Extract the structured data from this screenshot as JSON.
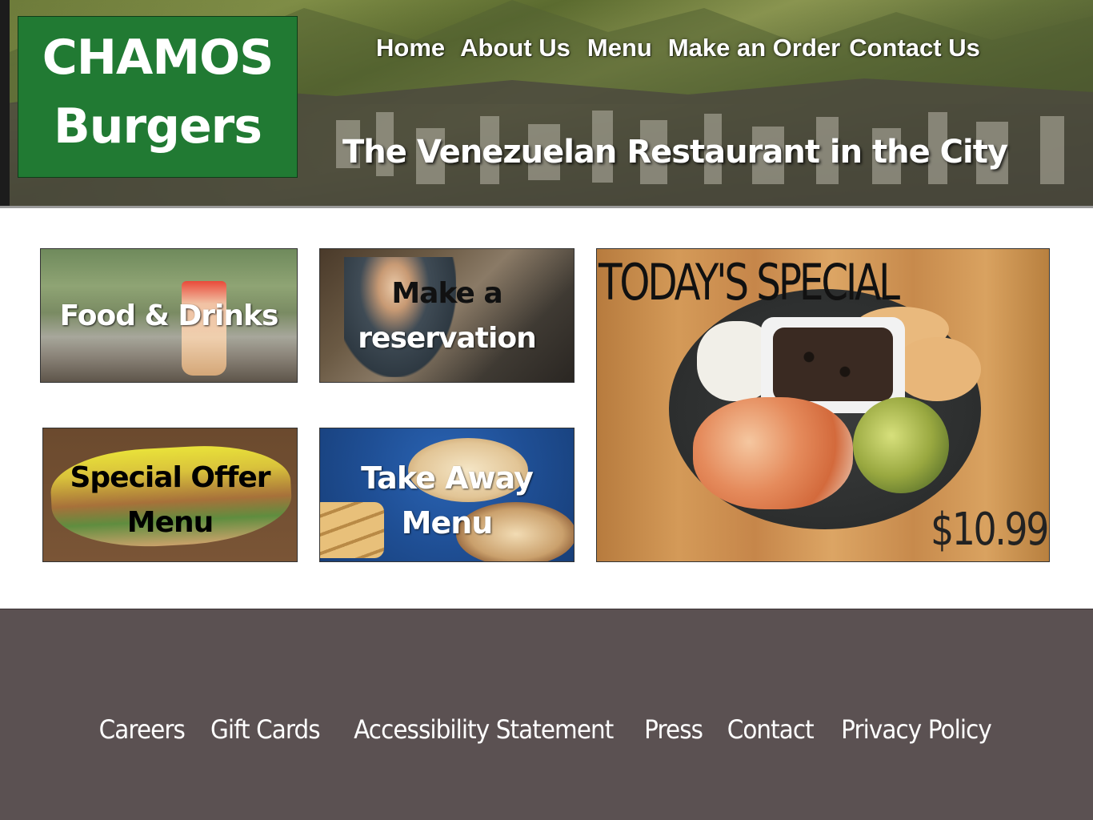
{
  "brand": {
    "line1": "CHAMOS",
    "line2": "Burgers",
    "color": "#217a33"
  },
  "nav": [
    {
      "label": "Home"
    },
    {
      "label": "About Us"
    },
    {
      "label": "Menu"
    },
    {
      "label": "Make an Order"
    },
    {
      "label": "Contact Us"
    }
  ],
  "tagline": "The Venezuelan Restaurant in the City",
  "tiles": {
    "food_drinks": {
      "label": "Food & Drinks"
    },
    "reservation": {
      "label_line1": "Make a",
      "label_line2": "reservation"
    },
    "special_offer": {
      "label_line1": "Special Offer",
      "label_line2": "Menu"
    },
    "take_away": {
      "label_line1": "Take Away",
      "label_line2": "Menu"
    },
    "todays_special": {
      "title": "TODAY'S SPECIAL",
      "price": "$10.99"
    }
  },
  "footer": {
    "links": [
      {
        "label": "Careers"
      },
      {
        "label": "Gift Cards"
      },
      {
        "label": "Accessibility Statement"
      },
      {
        "label": "Press"
      },
      {
        "label": "Contact"
      },
      {
        "label": "Privacy Policy"
      }
    ],
    "background": "#5b5152"
  }
}
